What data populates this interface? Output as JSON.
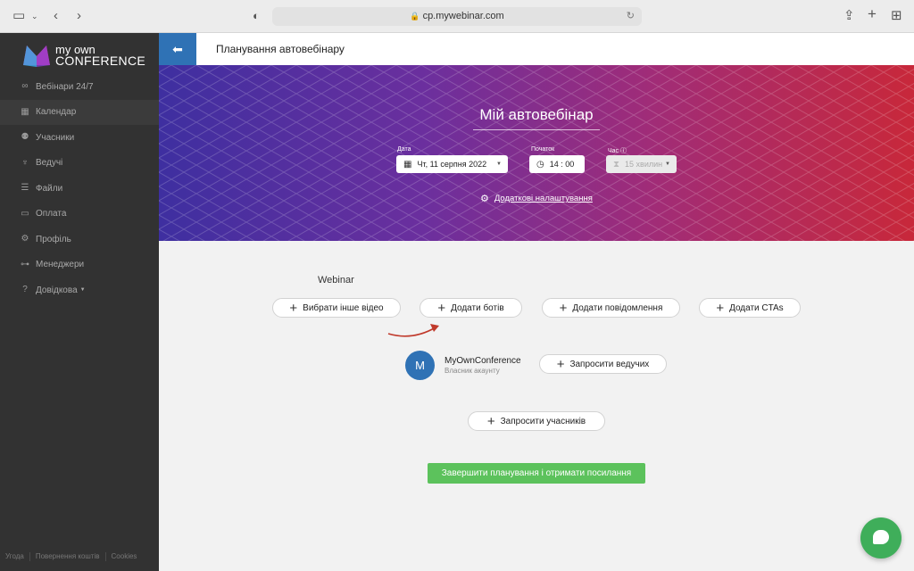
{
  "browser": {
    "url": "cp.mywebinar.com"
  },
  "brand": {
    "line1": "my own",
    "line2": "CONFERENCE"
  },
  "sidebar": {
    "items": [
      {
        "label": "Вебінари 24/7",
        "icon": "infinity-icon"
      },
      {
        "label": "Календар",
        "icon": "calendar-icon"
      },
      {
        "label": "Учасники",
        "icon": "users-icon"
      },
      {
        "label": "Ведучі",
        "icon": "microphone-icon"
      },
      {
        "label": "Файли",
        "icon": "database-icon"
      },
      {
        "label": "Оплата",
        "icon": "credit-card-icon"
      },
      {
        "label": "Профіль",
        "icon": "gear-icon"
      },
      {
        "label": "Менеджери",
        "icon": "sitemap-icon"
      },
      {
        "label": "Довідкова",
        "icon": "help-icon"
      }
    ],
    "active_index": 1,
    "footer": [
      "Угода",
      "Повернення коштів",
      "Cookies"
    ]
  },
  "header": {
    "title": "Планування автовебінару"
  },
  "hero": {
    "title": "Мій автовебінар",
    "date_label": "Дата",
    "date_value": "Чт, 11 серпня 2022",
    "start_label": "Початок",
    "start_value": "14 : 00",
    "time_label": "Час ⓘ",
    "time_value": "15 хвилин",
    "advanced_settings": "Додаткові налаштування"
  },
  "content": {
    "section_label": "Webinar",
    "buttons": {
      "choose_video": "Вибрати інше відео",
      "add_bots": "Додати ботів",
      "add_messages": "Додати повідомлення",
      "add_ctas": "Додати CTAs",
      "invite_hosts": "Запросити ведучих",
      "invite_participants": "Запросити учасників"
    },
    "host": {
      "initial": "M",
      "name": "MyOwnConference",
      "role": "Власник акаунту"
    },
    "finish_button": "Завершити планування і отримати посилання"
  },
  "colors": {
    "sidebar_bg": "#323232",
    "accent_blue": "#2f72b5",
    "finish_green": "#5cc25c",
    "chat_green": "#3fae5a",
    "arrow_red": "#c0392b"
  }
}
